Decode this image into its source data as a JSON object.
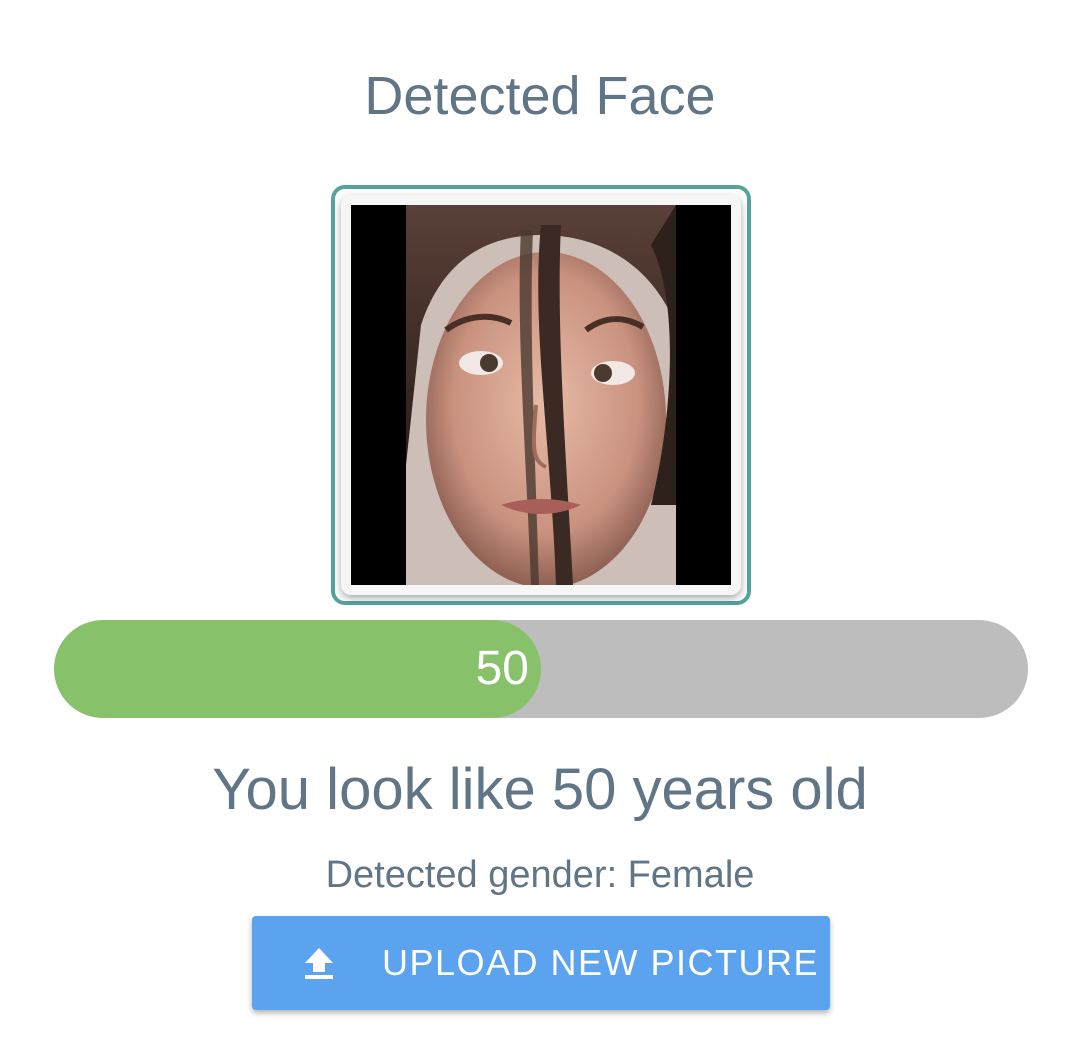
{
  "header": {
    "title": "Detected Face"
  },
  "face": {
    "image": "cropped-face-photo",
    "frame_color": "#56a39c"
  },
  "age_bar": {
    "value_label": "50",
    "fraction": 0.5,
    "fill_color": "#87c26a",
    "track_color": "#bdbdbd"
  },
  "result": {
    "age_text": "You look like 50 years old",
    "gender_text": "Detected gender: Female"
  },
  "upload": {
    "label": "UPLOAD NEW PICTURE",
    "icon": "upload-icon",
    "color": "#5ba2ef"
  },
  "colors": {
    "text": "#607586"
  }
}
